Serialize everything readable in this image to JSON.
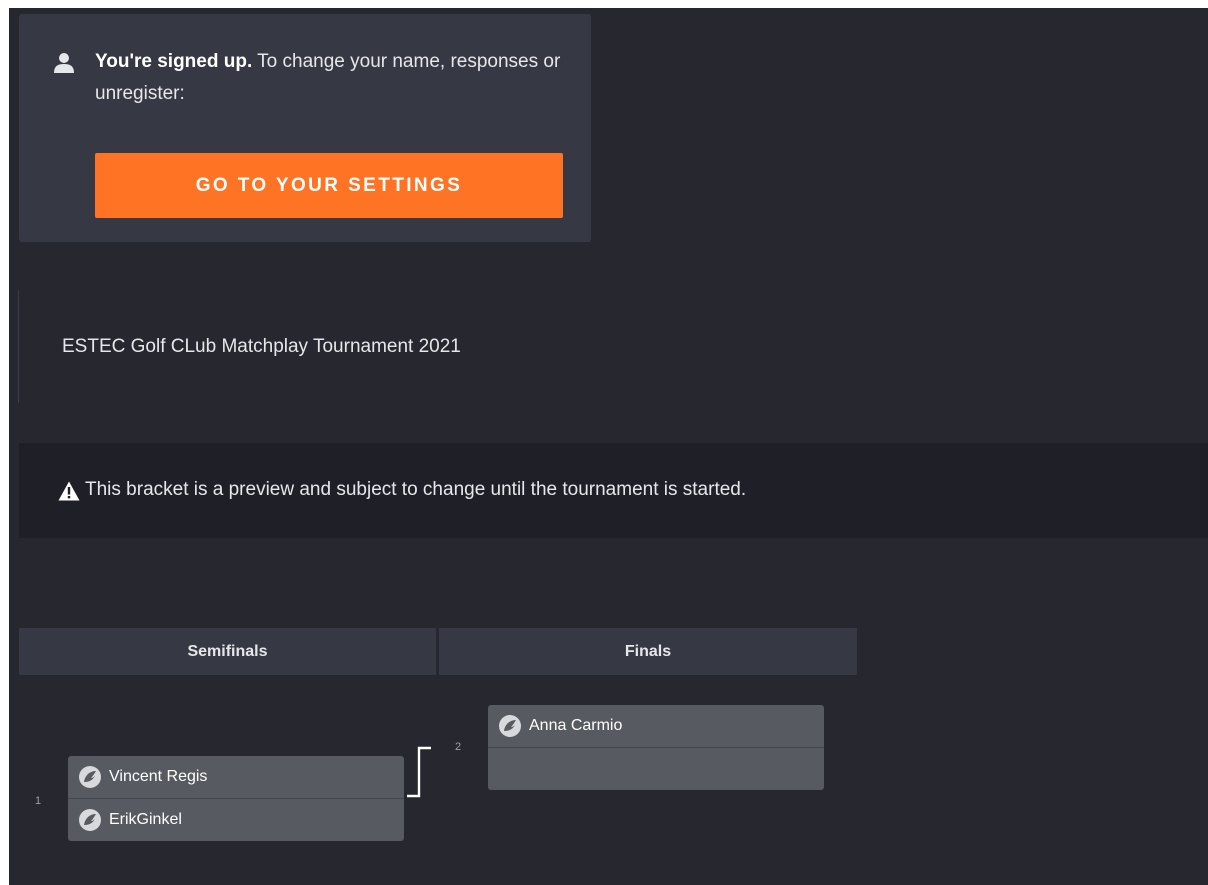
{
  "signup": {
    "icon": "user-icon",
    "bold_text": "You're signed up.",
    "text": " To change your name, responses or unregister:",
    "button_label": "GO TO YOUR SETTINGS",
    "button_color": "#ff7324"
  },
  "tournament": {
    "description": "ESTEC Golf CLub Matchplay Tournament 2021"
  },
  "notice": {
    "icon": "warning-icon",
    "text": "This bracket is a preview and subject to change until the tournament is started."
  },
  "bracket": {
    "rounds": [
      {
        "label": "Semifinals"
      },
      {
        "label": "Finals"
      }
    ],
    "matches": [
      {
        "number": "1",
        "round": "Semifinals",
        "players": [
          {
            "name": "Vincent Regis",
            "icon": "player-avatar-icon"
          },
          {
            "name": "ErikGinkel",
            "icon": "player-avatar-icon"
          }
        ]
      },
      {
        "number": "2",
        "round": "Finals",
        "players": [
          {
            "name": "Anna Carmio",
            "icon": "player-avatar-icon"
          },
          {
            "name": "",
            "icon": ""
          }
        ]
      }
    ]
  },
  "colors": {
    "background": "#26272f",
    "card": "#363843",
    "accent": "#ff7324",
    "match_slot": "#585a62"
  }
}
